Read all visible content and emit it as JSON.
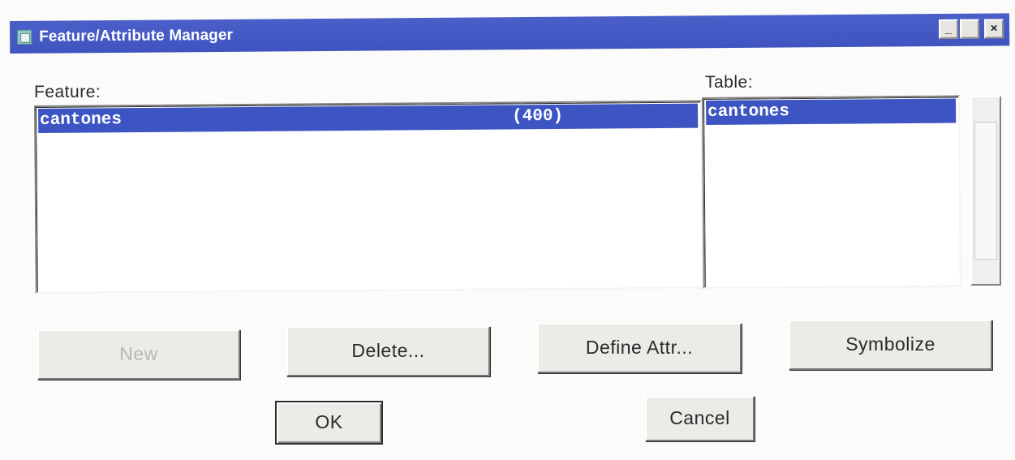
{
  "window": {
    "title": "Feature/Attribute Manager",
    "minimize_glyph": "_",
    "maximize_glyph": "",
    "close_glyph": "×"
  },
  "feature": {
    "label": "Feature:",
    "items": [
      {
        "name": "cantones",
        "count": "(400)",
        "selected": true
      }
    ]
  },
  "table": {
    "label": "Table:",
    "items": [
      {
        "name": "cantones",
        "selected": true
      }
    ]
  },
  "buttons": {
    "new": "New",
    "delete": "Delete...",
    "define_attr": "Define Attr...",
    "symbolize": "Symbolize",
    "ok": "OK",
    "cancel": "Cancel"
  },
  "colors": {
    "titlebar": "#3f54c0",
    "selection": "#3c55c3",
    "face": "#ecebe8"
  },
  "icons": {
    "app": "feature-manager-app-icon"
  }
}
